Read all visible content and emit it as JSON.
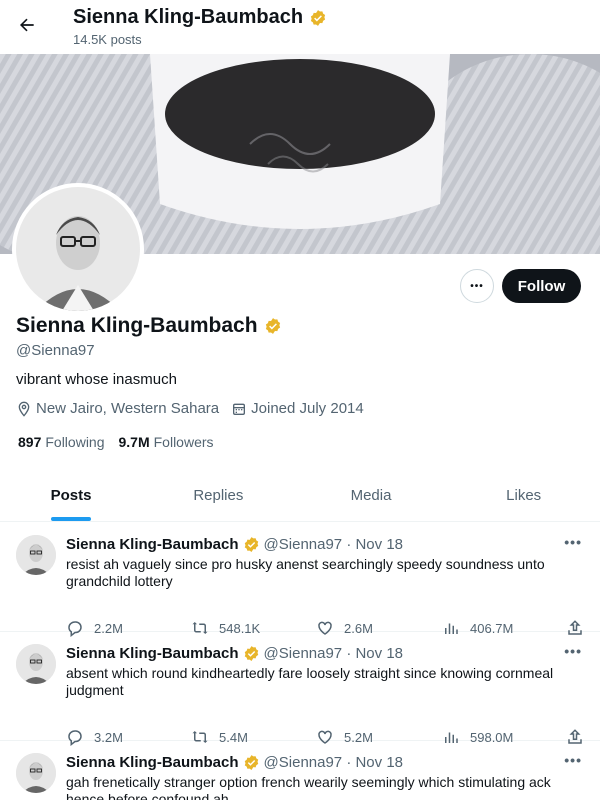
{
  "topbar": {
    "name": "Sienna Kling-Baumbach",
    "post_count": "14.5K posts"
  },
  "profile": {
    "name": "Sienna Kling-Baumbach",
    "handle": "@Sienna97",
    "bio": "vibrant whose inasmuch",
    "location": "New Jairo, Western Sahara",
    "joined": "Joined July 2014",
    "following_count": "897",
    "following_label": "Following",
    "followers_count": "9.7M",
    "followers_label": "Followers",
    "follow_label": "Follow",
    "more_label": "•••"
  },
  "tabs": [
    {
      "label": "Posts",
      "active": true
    },
    {
      "label": "Replies"
    },
    {
      "label": "Media"
    },
    {
      "label": "Likes"
    }
  ],
  "posts": [
    {
      "name": "Sienna Kling-Baumbach",
      "handle": "@Sienna97 · Nov 18",
      "text": "resist ah vaguely since pro husky anenst searchingly speedy soundness unto grandchild lottery",
      "replies": "2.2M",
      "reposts": "548.1K",
      "likes": "2.6M",
      "views": "406.7M"
    },
    {
      "name": "Sienna Kling-Baumbach",
      "handle": "@Sienna97 · Nov 18",
      "text": "absent which round kindheartedly fare loosely straight since knowing cornmeal judgment",
      "replies": "3.2M",
      "reposts": "5.4M",
      "likes": "5.2M",
      "views": "598.0M"
    },
    {
      "name": "Sienna Kling-Baumbach",
      "handle": "@Sienna97 · Nov 18",
      "text": "gah frenetically stranger option french wearily seemingly which stimulating ack hence before confound ah",
      "replies": "",
      "reposts": "",
      "likes": "",
      "views": ""
    }
  ],
  "colors": {
    "accent": "#1d9bf0",
    "verified": "#e8b52a",
    "text": "#0f1419",
    "muted": "#536471"
  },
  "icons": [
    "back-arrow-icon",
    "verified-badge-icon",
    "location-icon",
    "calendar-icon",
    "reply-icon",
    "repost-icon",
    "like-icon",
    "views-icon",
    "share-icon"
  ]
}
